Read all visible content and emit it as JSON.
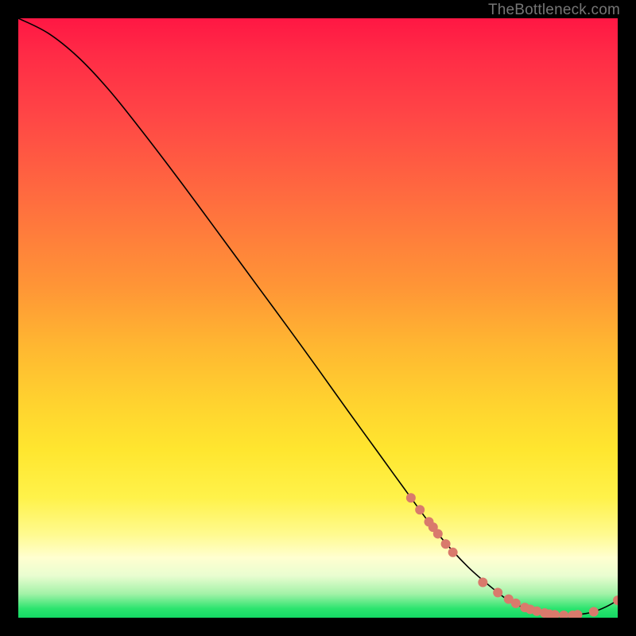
{
  "watermark": "TheBottleneck.com",
  "chart_data": {
    "type": "line",
    "title": "",
    "xlabel": "",
    "ylabel": "",
    "xlim": [
      0,
      100
    ],
    "ylim": [
      0,
      100
    ],
    "grid": false,
    "legend": false,
    "series": [
      {
        "name": "bottleneck-curve",
        "color": "#000000",
        "x": [
          0,
          5,
          10,
          15,
          20,
          25,
          30,
          35,
          40,
          45,
          50,
          55,
          60,
          65,
          70,
          75,
          80,
          82,
          84,
          86,
          88,
          90,
          92,
          94,
          96,
          98,
          100
        ],
        "y": [
          100,
          97.5,
          93.5,
          88.2,
          82.0,
          75.5,
          68.8,
          62.0,
          55.2,
          48.4,
          41.5,
          34.5,
          27.6,
          20.7,
          14.0,
          8.5,
          4.2,
          2.8,
          1.8,
          1.1,
          0.6,
          0.4,
          0.4,
          0.6,
          1.0,
          1.8,
          2.9
        ]
      }
    ],
    "markers": {
      "name": "highlighted-points",
      "color": "#d97a6c",
      "radius_px": 6,
      "x": [
        65.5,
        67.0,
        68.5,
        69.2,
        70.0,
        71.3,
        72.5,
        77.5,
        80.0,
        81.8,
        83.0,
        84.5,
        85.4,
        86.5,
        87.8,
        88.6,
        89.5,
        91.0,
        92.5,
        93.3,
        96.0,
        100.0
      ],
      "y": [
        20.0,
        18.0,
        16.0,
        15.1,
        14.0,
        12.3,
        10.9,
        5.9,
        4.2,
        3.1,
        2.4,
        1.7,
        1.4,
        1.1,
        0.8,
        0.6,
        0.5,
        0.4,
        0.4,
        0.5,
        1.0,
        2.9
      ]
    }
  }
}
